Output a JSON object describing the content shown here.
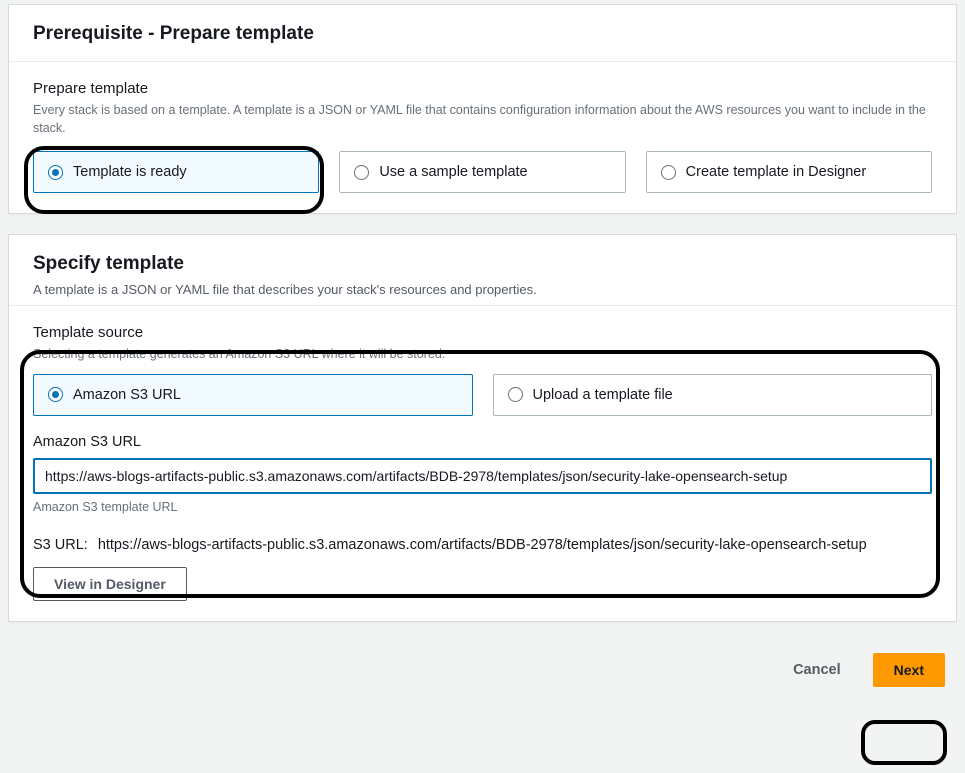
{
  "panel1": {
    "title": "Prerequisite - Prepare template",
    "prepare_label": "Prepare template",
    "prepare_desc": "Every stack is based on a template. A template is a JSON or YAML file that contains configuration information about the AWS resources you want to include in the stack.",
    "options": {
      "ready": "Template is ready",
      "sample": "Use a sample template",
      "designer": "Create template in Designer"
    }
  },
  "panel2": {
    "title": "Specify template",
    "desc": "A template is a JSON or YAML file that describes your stack's resources and properties.",
    "source_label": "Template source",
    "source_desc": "Selecting a template generates an Amazon S3 URL where it will be stored.",
    "source_options": {
      "s3": "Amazon S3 URL",
      "upload": "Upload a template file"
    },
    "url_label": "Amazon S3 URL",
    "url_value": "https://aws-blogs-artifacts-public.s3.amazonaws.com/artifacts/BDB-2978/templates/json/security-lake-opensearch-setup",
    "url_helper": "Amazon S3 template URL",
    "s3url_label": "S3 URL:",
    "s3url_value": "https://aws-blogs-artifacts-public.s3.amazonaws.com/artifacts/BDB-2978/templates/json/security-lake-opensearch-setup",
    "view_designer": "View in Designer"
  },
  "footer": {
    "cancel": "Cancel",
    "next": "Next"
  }
}
